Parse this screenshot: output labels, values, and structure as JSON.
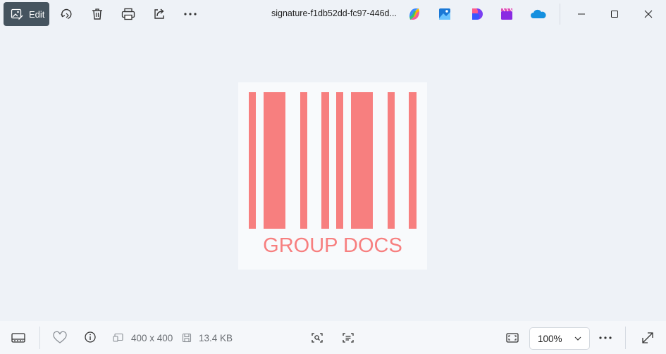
{
  "toolbar": {
    "edit_label": "Edit",
    "file_name": "signature-f1db52dd-fc97-446d..."
  },
  "image": {
    "caption": "GROUP DOCS",
    "bar_color": "#f77f7f"
  },
  "bottom": {
    "dimensions": "400 x 400",
    "file_size": "13.4 KB",
    "zoom": "100%"
  },
  "colors": {
    "edit_bg": "#45545f",
    "background": "#eef2f7"
  }
}
